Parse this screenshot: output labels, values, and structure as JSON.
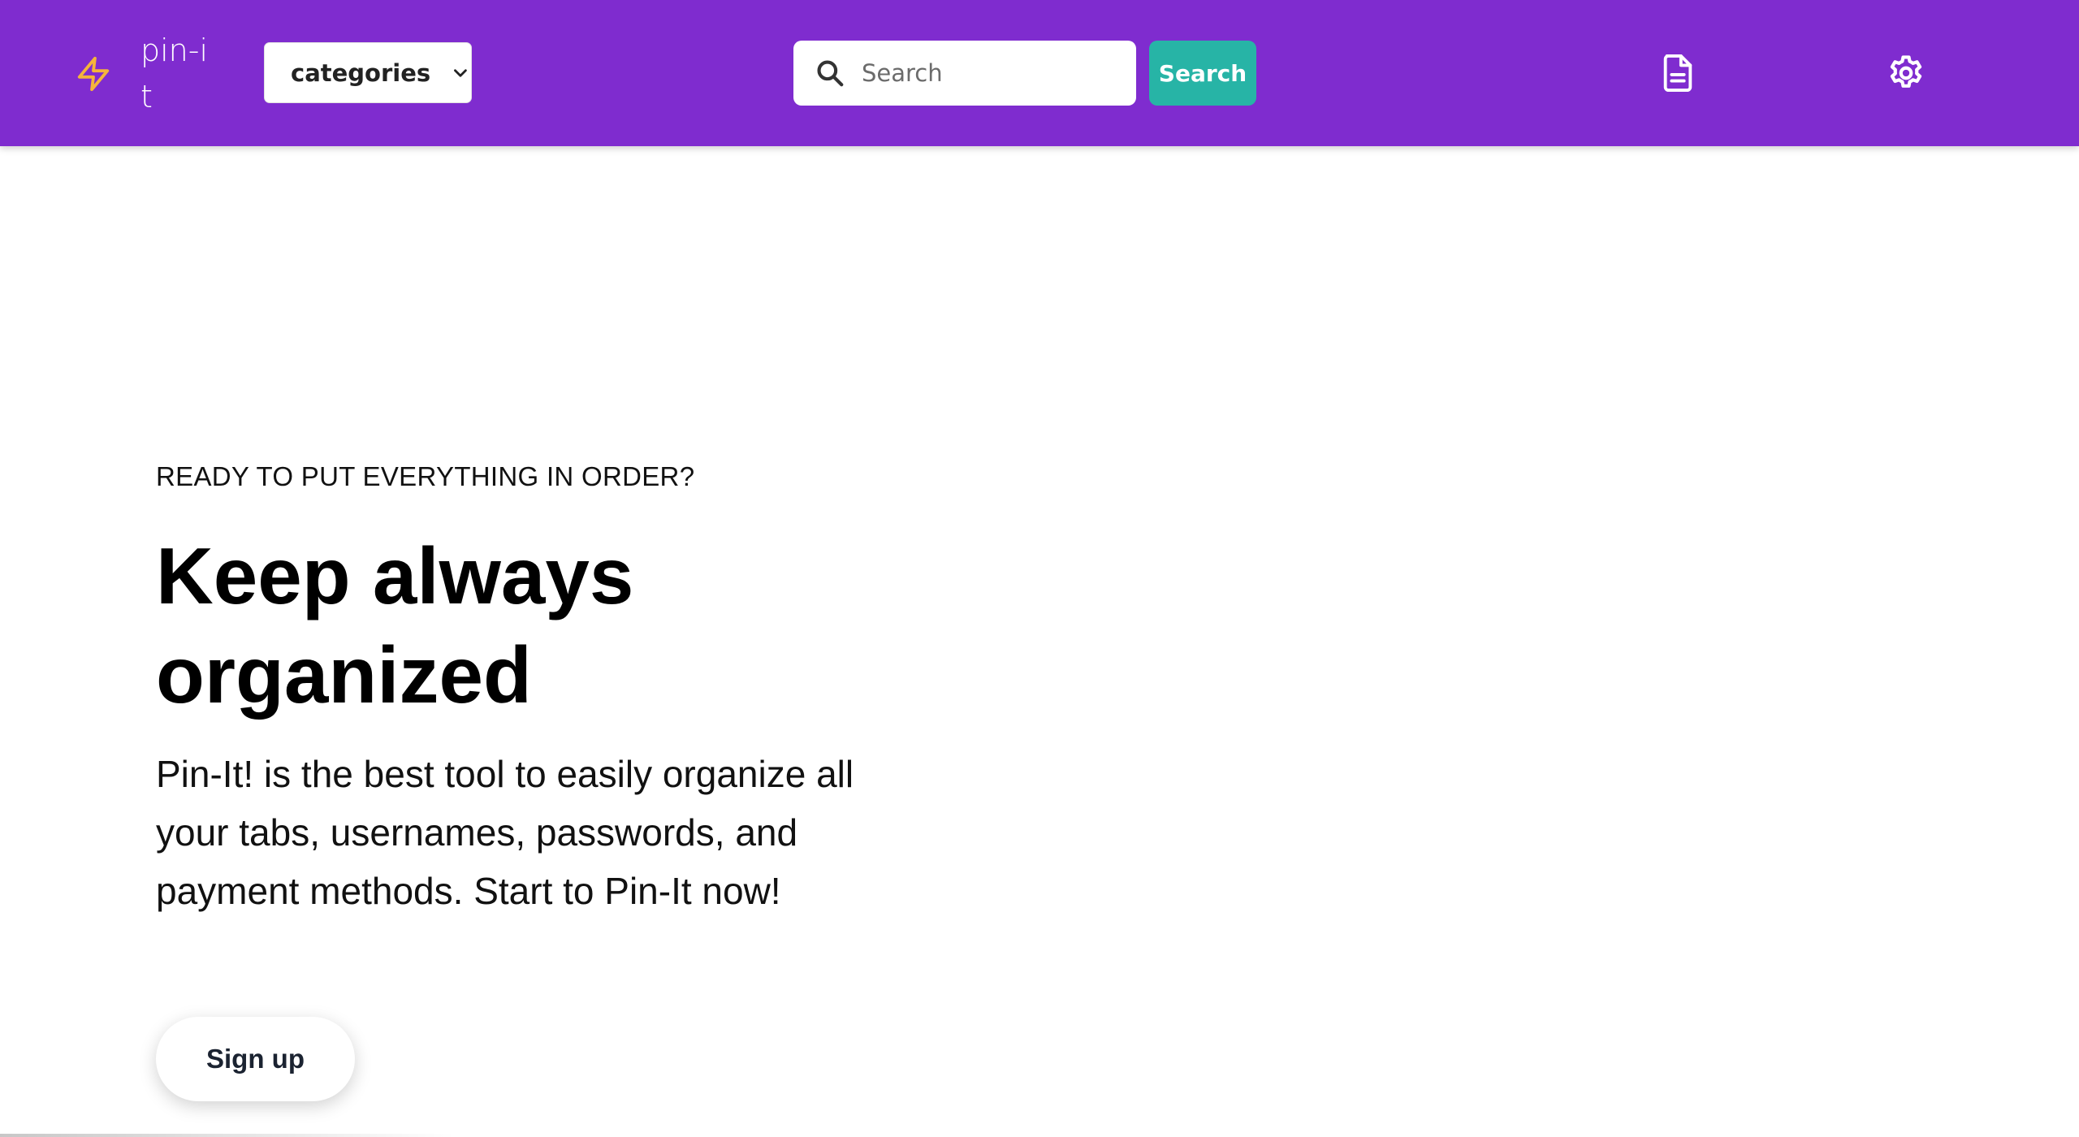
{
  "navbar": {
    "brand": "pin-it",
    "categories_label": "categories",
    "search": {
      "placeholder": "Search",
      "value": ""
    },
    "search_button": "Search",
    "icons": [
      "zap-icon",
      "chevron-down-icon",
      "search-icon",
      "document-icon",
      "gear-icon"
    ]
  },
  "hero": {
    "eyebrow": "READY TO PUT EVERYTHING IN ORDER?",
    "headline": "Keep always organized",
    "description": "Pin-It! is the best tool to easily organize all your tabs, usernames, passwords, and payment methods. Start to Pin-It now!",
    "cta": "Sign up"
  },
  "colors": {
    "navbar_bg": "#7f2ccf",
    "logo_accent": "#f5b43a",
    "search_button_bg": "#27b4a6",
    "text_primary": "#000000"
  }
}
